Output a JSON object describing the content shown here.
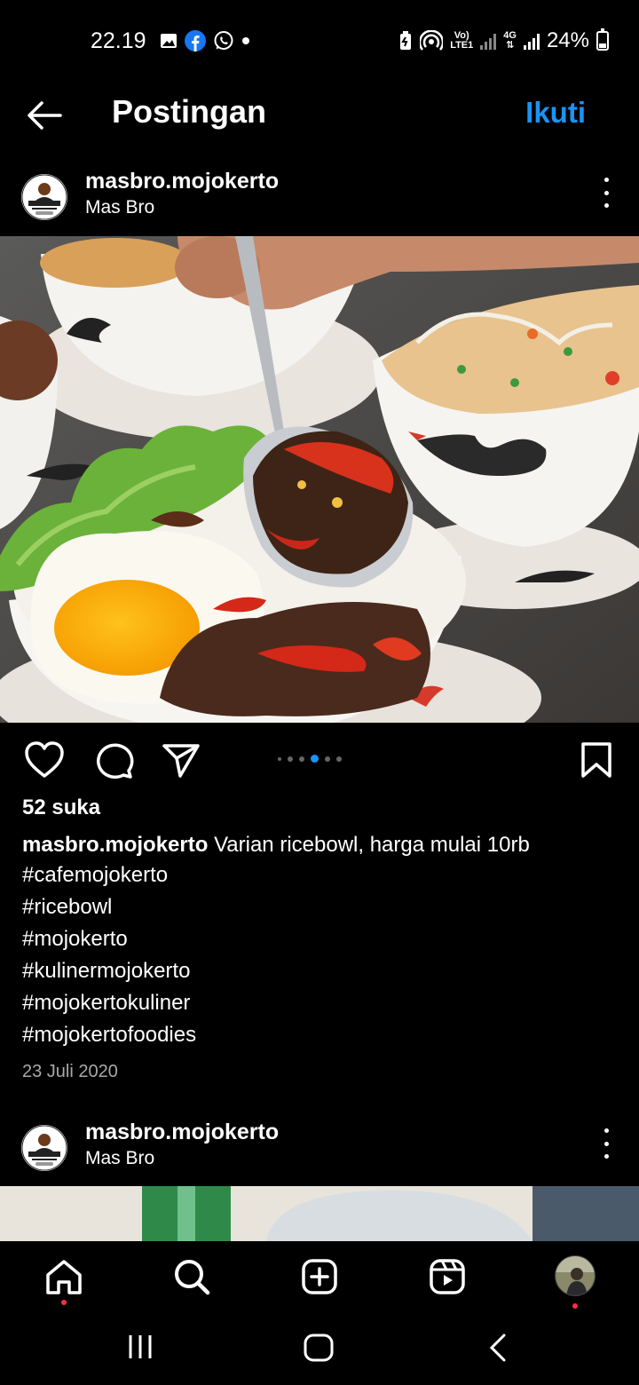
{
  "status_bar": {
    "time": "22.19",
    "notification_icons": [
      "gallery-icon",
      "facebook-icon",
      "whatsapp-icon",
      "dot-icon"
    ],
    "volte_label": "Vo)",
    "lte_label": "LTE1",
    "network_label": "4G",
    "battery": "24%"
  },
  "header": {
    "title": "Postingan",
    "follow_label": "Ikuti"
  },
  "post": {
    "username": "masbro.mojokerto",
    "fullname": "Mas Bro",
    "likes": "52 suka",
    "caption_user": "masbro.mojokerto",
    "caption_text": "Varian ricebowl, harga mulai 10rb",
    "hashtags": [
      "#cafemojokerto",
      "#ricebowl",
      "#mojokerto",
      "#kulinermojokerto",
      "#mojokertokuliner",
      "#mojokertofoodies"
    ],
    "date": "23 Juli 2020",
    "carousel": {
      "count": 6,
      "active": 3
    }
  },
  "next_post": {
    "username": "masbro.mojokerto",
    "fullname": "Mas Bro"
  },
  "bottom_nav": [
    "home-icon",
    "search-icon",
    "create-icon",
    "reels-icon",
    "profile-avatar"
  ],
  "colors": {
    "accent": "#1a94f6",
    "notification_dot": "#ff3040",
    "background": "#000000"
  }
}
